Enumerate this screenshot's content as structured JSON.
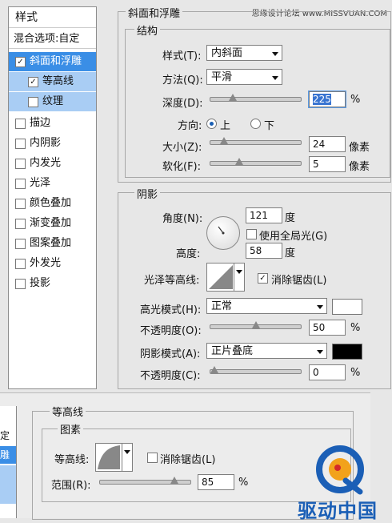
{
  "watermark_top": "思缘设计论坛 www.MISSVUAN.COM",
  "styles_list": {
    "header": "样式",
    "blend_options": "混合选项:自定",
    "items": [
      {
        "label": "斜面和浮雕",
        "checked": true
      },
      {
        "label": "等高线",
        "checked": true
      },
      {
        "label": "纹理",
        "checked": false
      },
      {
        "label": "描边",
        "checked": false
      },
      {
        "label": "内阴影",
        "checked": false
      },
      {
        "label": "内发光",
        "checked": false
      },
      {
        "label": "光泽",
        "checked": false
      },
      {
        "label": "颜色叠加",
        "checked": false
      },
      {
        "label": "渐变叠加",
        "checked": false
      },
      {
        "label": "图案叠加",
        "checked": false
      },
      {
        "label": "外发光",
        "checked": false
      },
      {
        "label": "投影",
        "checked": false
      }
    ],
    "check_mark": "✓"
  },
  "bevel": {
    "title": "斜面和浮雕",
    "structure_title": "结构",
    "style_label": "样式(T):",
    "style_value": "内斜面",
    "technique_label": "方法(Q):",
    "technique_value": "平滑",
    "depth_label": "深度(D):",
    "depth_value": "225",
    "depth_unit": "%",
    "depth_fraction": 0.22,
    "direction_label": "方向:",
    "direction_up": "上",
    "direction_down": "下",
    "size_label": "大小(Z):",
    "size_value": "24",
    "size_unit": "像素",
    "size_fraction": 0.12,
    "soften_label": "软化(F):",
    "soften_value": "5",
    "soften_unit": "像素",
    "soften_fraction": 0.3
  },
  "shading": {
    "title": "阴影",
    "angle_label": "角度(N):",
    "angle_value": "121",
    "angle_unit": "度",
    "global_light_label": "使用全局光(G)",
    "altitude_label": "高度:",
    "altitude_value": "58",
    "altitude_unit": "度",
    "gloss_contour_label": "光泽等高线:",
    "antialiased_label": "消除锯齿(L)",
    "highlight_mode_label": "高光模式(H):",
    "highlight_mode_value": "正常",
    "highlight_color": "#ffffff",
    "highlight_opacity_label": "不透明度(O):",
    "highlight_opacity_value": "50",
    "highlight_opacity_unit": "%",
    "highlight_opacity_fraction": 0.5,
    "shadow_mode_label": "阴影模式(A):",
    "shadow_mode_value": "正片叠底",
    "shadow_color": "#000000",
    "shadow_opacity_label": "不透明度(C):",
    "shadow_opacity_value": "0",
    "shadow_opacity_unit": "%",
    "shadow_opacity_fraction": 0.0
  },
  "contour_panel": {
    "title": "等高线",
    "elements_title": "图素",
    "contour_label": "等高线:",
    "antialiased_label": "消除锯齿(L)",
    "range_label": "范围(R):",
    "range_value": "85",
    "range_unit": "%",
    "range_fraction": 0.85
  },
  "left_fragment": {
    "item1": "定",
    "item2": "雕"
  },
  "logo_text": "驱动中国"
}
